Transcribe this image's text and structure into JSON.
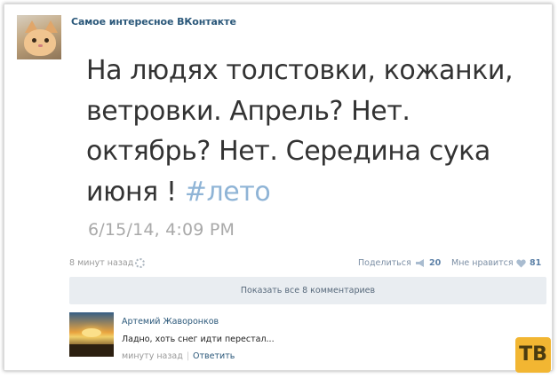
{
  "post": {
    "community_name": "Самое интересное ВКонтакте",
    "tweet_text": "На людях толстовки, кожанки, ветровки. Апрель? Нет. октябрь? Нет. Середина сука июня ! ",
    "hashtag": "#лето",
    "tweet_date": "6/15/14, 4:09 PM",
    "time_ago": "8 минут назад",
    "share_label": "Поделиться",
    "share_count": "20",
    "like_label": "Мне нравится",
    "like_count": "81"
  },
  "comments": {
    "show_all_label": "Показать все 8 комментариев",
    "items": [
      {
        "author": "Артемий Жаворонков",
        "text": "Ладно, хоть снег идти перестал...",
        "time": "минуту назад",
        "separator": "|",
        "reply_label": "Ответить"
      }
    ]
  },
  "watermark": {
    "logo_text": "ТВ"
  },
  "colors": {
    "link": "#2b587a",
    "hashtag": "#8fb4d6",
    "accent_count": "#5e82a8",
    "watermark": "#f2b632"
  }
}
